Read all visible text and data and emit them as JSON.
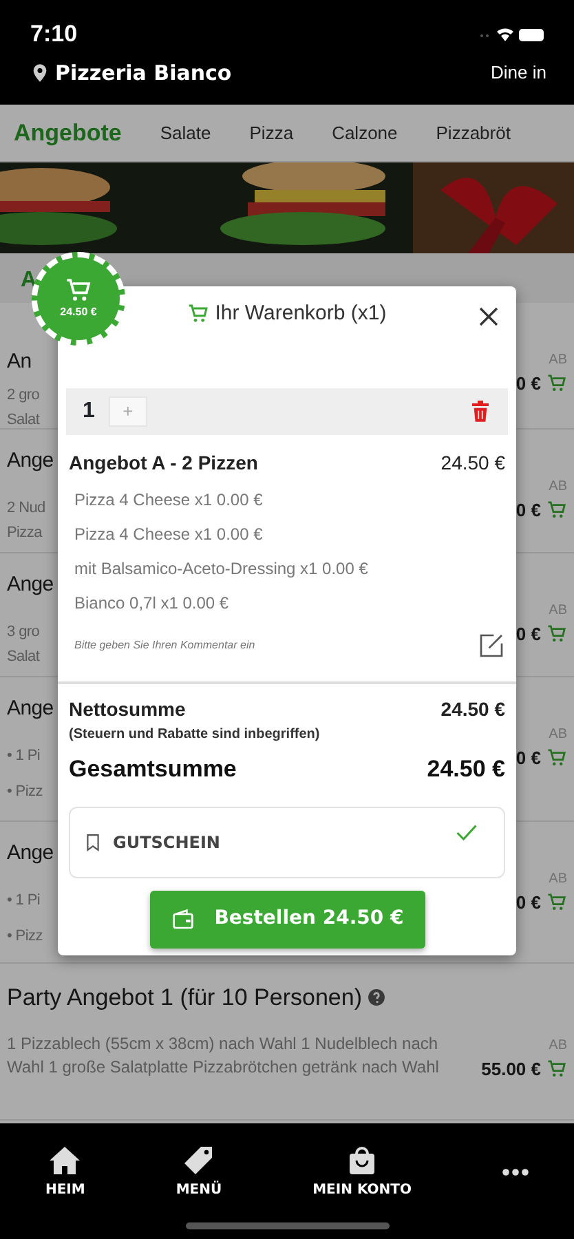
{
  "status_bar": {
    "time": "7:10"
  },
  "header": {
    "location": "Pizzeria Bianco",
    "mode": "Dine in"
  },
  "tabs": [
    {
      "label": "Angebote",
      "selected": true
    },
    {
      "label": "Salate",
      "selected": false
    },
    {
      "label": "Pizza",
      "selected": false
    },
    {
      "label": "Calzone",
      "selected": false
    },
    {
      "label": "Pizzabröt",
      "selected": false
    }
  ],
  "section_title": "A",
  "menu_items": [
    {
      "title": "An",
      "lines": [
        "2 gro",
        "Salat"
      ],
      "from": "AB",
      "price": "0 €"
    },
    {
      "title": "Ange",
      "lines": [
        "2 Nud",
        "Pizza"
      ],
      "from": "AB",
      "price": "0 €"
    },
    {
      "title": "Ange",
      "lines": [
        "3 gro",
        "Salat"
      ],
      "from": "AB",
      "price": "0 €"
    },
    {
      "title": "Ange",
      "lines": [
        "• 1 Pi",
        "• Pizz"
      ],
      "from": "AB",
      "price": "0 €"
    },
    {
      "title": "Ange",
      "lines": [
        "• 1 Pi",
        "• Pizz"
      ],
      "from": "AB",
      "price": "0 €"
    }
  ],
  "party_item": {
    "title": "Party Angebot 1 (für 10 Personen)",
    "description": "1 Pizzablech (55cm x 38cm) nach Wahl 1 Nudelblech nach Wahl 1 große Salatplatte Pizzabrötchen getränk nach Wahl",
    "from": "AB",
    "price": "55.00 €"
  },
  "cart_badge": {
    "total": "24.50 €"
  },
  "cart": {
    "title": "Ihr Warenkorb (x1)",
    "quantity": "1",
    "plus": "+",
    "item": {
      "name": "Angebot A - 2 Pizzen",
      "price": "24.50 €",
      "options": [
        "Pizza 4 Cheese x1 0.00 €",
        "Pizza 4 Cheese x1 0.00 €",
        "mit Balsamico-Aceto-Dressing x1 0.00 €",
        "Bianco 0,7l x1 0.00 €"
      ]
    },
    "comment_placeholder": "Bitte geben Sie Ihren Kommentar ein",
    "net_label": "Nettosumme",
    "net_value": "24.50 €",
    "tax_note": "(Steuern und Rabatte sind inbegriffen)",
    "total_label": "Gesamtsumme",
    "total_value": "24.50 €",
    "voucher": {
      "label": "GUTSCHEIN",
      "applied": true
    },
    "order_button": "Bestellen 24.50 €"
  },
  "bottom_nav": [
    {
      "kind": "home",
      "label": "HEIM"
    },
    {
      "kind": "tag",
      "label": "MENÜ"
    },
    {
      "kind": "bag",
      "label": "MEIN KONTO"
    },
    {
      "kind": "more"
    }
  ]
}
